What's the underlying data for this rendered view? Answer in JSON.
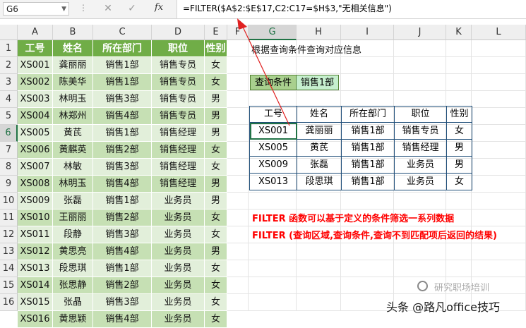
{
  "formula_bar": {
    "name_box": "G6",
    "cancel_icon": "✕",
    "enter_icon": "✓",
    "fx_label": "fx",
    "formula": "=FILTER($A$2:$E$17,C2:C17=$H$3,\"无相关信息\")"
  },
  "columns": [
    "A",
    "B",
    "C",
    "D",
    "E",
    "F",
    "G",
    "H",
    "I",
    "J",
    "K",
    "L"
  ],
  "selected_column": "G",
  "rows": [
    "1",
    "2",
    "3",
    "4",
    "5",
    "6",
    "7",
    "8",
    "9",
    "10",
    "11",
    "12",
    "13",
    "14",
    "15",
    "16"
  ],
  "selected_row": "6",
  "source_table": {
    "headers": [
      "工号",
      "姓名",
      "所在部门",
      "职位",
      "性别"
    ],
    "rows": [
      [
        "XS001",
        "龚丽丽",
        "销售1部",
        "销售专员",
        "女"
      ],
      [
        "XS002",
        "陈美华",
        "销售1部",
        "销售专员",
        "女"
      ],
      [
        "XS003",
        "林明玉",
        "销售3部",
        "销售专员",
        "男"
      ],
      [
        "XS004",
        "林郑州",
        "销售4部",
        "销售专员",
        "男"
      ],
      [
        "XS005",
        "黄芪",
        "销售1部",
        "销售经理",
        "男"
      ],
      [
        "XS006",
        "黄麒英",
        "销售2部",
        "销售经理",
        "女"
      ],
      [
        "XS007",
        "林敏",
        "销售3部",
        "销售经理",
        "女"
      ],
      [
        "XS008",
        "林明玉",
        "销售4部",
        "销售经理",
        "男"
      ],
      [
        "XS009",
        "张磊",
        "销售1部",
        "业务员",
        "男"
      ],
      [
        "XS010",
        "王丽丽",
        "销售2部",
        "业务员",
        "女"
      ],
      [
        "XS011",
        "段静",
        "销售3部",
        "业务员",
        "女"
      ],
      [
        "XS012",
        "黄思亮",
        "销售4部",
        "业务员",
        "男"
      ],
      [
        "XS013",
        "段思琪",
        "销售1部",
        "业务员",
        "女"
      ],
      [
        "XS014",
        "张思静",
        "销售2部",
        "业务员",
        "女"
      ],
      [
        "XS015",
        "张晶",
        "销售3部",
        "业务员",
        "女"
      ],
      [
        "XS016",
        "黄思颖",
        "销售4部",
        "业务员",
        "女"
      ]
    ]
  },
  "title_text": "根据查询条件查询对应信息",
  "query": {
    "label": "查询条件",
    "value": "销售1部"
  },
  "result_table": {
    "headers": [
      "工号",
      "姓名",
      "所在部门",
      "职位",
      "性别"
    ],
    "rows": [
      [
        "XS001",
        "龚丽丽",
        "销售1部",
        "销售专员",
        "女"
      ],
      [
        "XS005",
        "黄芪",
        "销售1部",
        "销售经理",
        "男"
      ],
      [
        "XS009",
        "张磊",
        "销售1部",
        "业务员",
        "男"
      ],
      [
        "XS013",
        "段思琪",
        "销售1部",
        "业务员",
        "女"
      ]
    ]
  },
  "notes": [
    "FILTER 函数可以基于定义的条件筛选一系列数据",
    "FILTER (查询区域,查询条件,查询不到匹配项后返回的结果)"
  ],
  "watermark": {
    "faint": "研究职场培训",
    "main": "头条 @路凡office技巧"
  },
  "colors": {
    "header_green": "#70ad47",
    "band_light": "#e2efda",
    "band_dark": "#c6e0b4",
    "note_red": "#ff0000",
    "arrow_red": "#e02020"
  }
}
